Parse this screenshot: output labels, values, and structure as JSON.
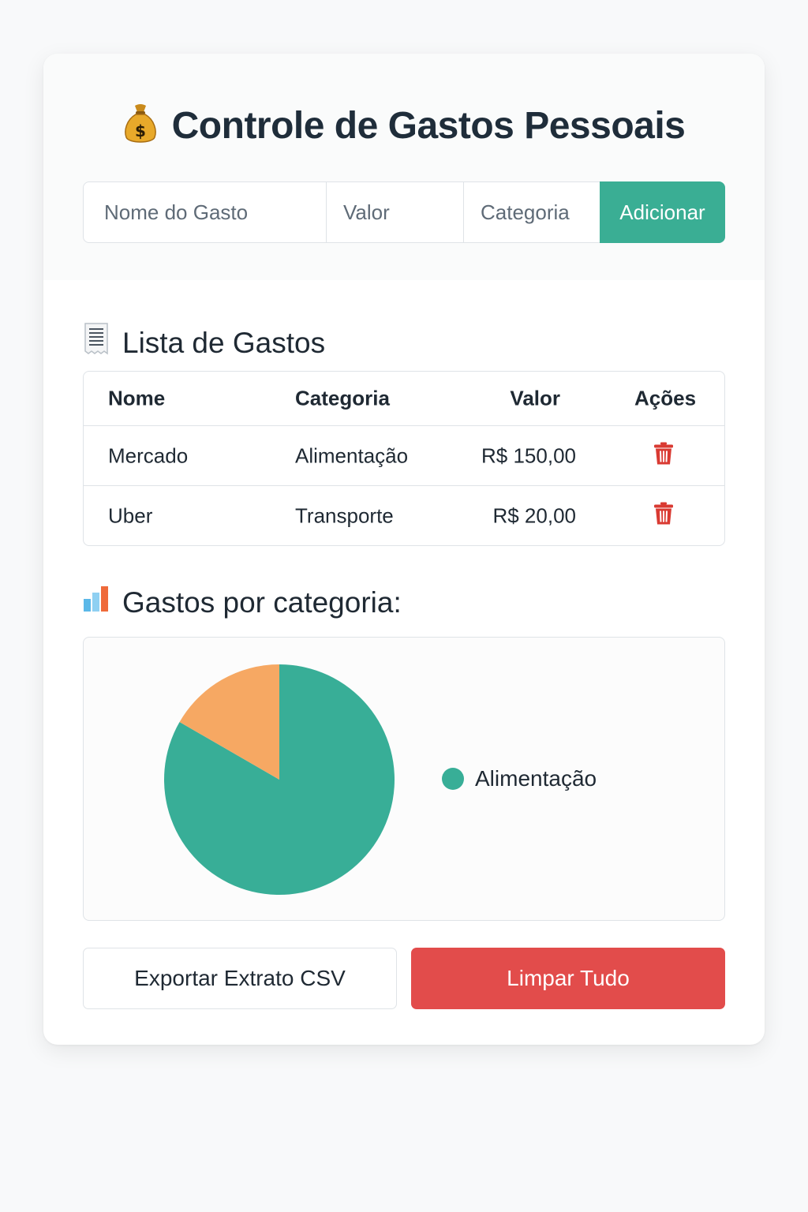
{
  "header": {
    "icon": "money-bag-icon",
    "title": "Controle de Gastos Pessoais"
  },
  "form": {
    "name_placeholder": "Nome do Gasto",
    "value_placeholder": "Valor",
    "category_placeholder": "Categoria",
    "add_label": "Adicionar"
  },
  "list": {
    "icon": "receipt-icon",
    "title": "Lista de Gastos",
    "columns": [
      "Nome",
      "Categoria",
      "Valor",
      "Ações"
    ],
    "rows": [
      {
        "nome": "Mercado",
        "categoria": "Alimentação",
        "valor": "R$ 150,00",
        "action_icon": "trash-icon"
      },
      {
        "nome": "Uber",
        "categoria": "Transporte",
        "valor": "R$ 20,00",
        "action_icon": "trash-icon"
      }
    ]
  },
  "summary": {
    "icon": "bar-chart-icon",
    "title": "Gastos por categoria:"
  },
  "chart_data": {
    "type": "pie",
    "categories": [
      "Alimentação",
      "Transporte"
    ],
    "values": [
      150,
      30
    ],
    "colors": [
      "#38ae97",
      "#f6a863"
    ],
    "legend": [
      "Alimentação"
    ],
    "legend_position": "right"
  },
  "actions": {
    "export_label": "Exportar Extrato CSV",
    "clear_label": "Limpar Tudo"
  },
  "colors": {
    "accent": "#3aae94",
    "danger": "#e24c4b",
    "trash": "#d93a32"
  }
}
